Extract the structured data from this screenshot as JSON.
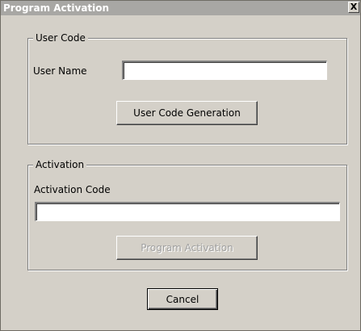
{
  "window": {
    "title": "Program Activation",
    "close_label": "X"
  },
  "user_code_group": {
    "legend": "User Code",
    "user_name_label": "User Name",
    "user_name_value": "",
    "generate_button_label": "User Code Generation"
  },
  "activation_group": {
    "legend": "Activation",
    "activation_code_label": "Activation Code",
    "activation_code_value": "",
    "activate_button_label": "Program Activation"
  },
  "footer": {
    "cancel_button_label": "Cancel"
  }
}
